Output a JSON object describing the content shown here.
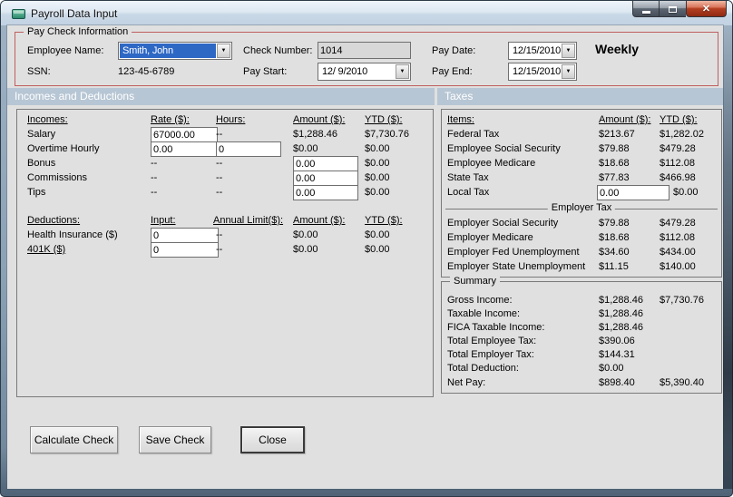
{
  "window": {
    "title": "Payroll Data Input",
    "close_glyph": "✕",
    "icons": [
      "form-icon",
      "minimize-icon",
      "maximize-icon",
      "close-icon",
      "chevron-down-icon"
    ]
  },
  "colors": {
    "selection_blue": "#2e68c5",
    "group_border_red": "#c05f5f",
    "panel_header_bg": "#b7c6d4",
    "client_bg": "#e0e0e0"
  },
  "paycheck": {
    "legend": "Pay Check Information",
    "employee_name_label": "Employee Name:",
    "employee_name_value": "Smith, John",
    "ssn_label": "SSN:",
    "ssn_value": "123-45-6789",
    "check_number_label": "Check Number:",
    "check_number_value": "1014",
    "pay_start_label": "Pay Start:",
    "pay_start_value": "12/ 9/2010",
    "pay_date_label": "Pay Date:",
    "pay_date_value": "12/15/2010",
    "pay_end_label": "Pay End:",
    "pay_end_value": "12/15/2010",
    "frequency": "Weekly",
    "dropdown_glyph": "▼"
  },
  "incomes_panel": {
    "header": "Incomes and Deductions",
    "income_headers": {
      "item": "Incomes:",
      "rate": "Rate ($):",
      "hours": "Hours:",
      "amount": "Amount ($):",
      "ytd": "YTD ($):"
    },
    "income_rows": [
      {
        "label": "Salary",
        "rate": "67000.00",
        "hours": "--",
        "amount": "$1,288.46",
        "ytd": "$7,730.76"
      },
      {
        "label": "Overtime Hourly",
        "rate": "0.00",
        "hours": "0",
        "amount": "$0.00",
        "ytd": "$0.00"
      },
      {
        "label": "Bonus",
        "rate": "--",
        "hours": "--",
        "amount": "0.00",
        "ytd": "$0.00"
      },
      {
        "label": "Commissions",
        "rate": "--",
        "hours": "--",
        "amount": "0.00",
        "ytd": "$0.00"
      },
      {
        "label": "Tips",
        "rate": "--",
        "hours": "--",
        "amount": "0.00",
        "ytd": "$0.00"
      }
    ],
    "deduction_headers": {
      "item": "Deductions:",
      "input": "Input:",
      "annual_limit": "Annual Limit($):",
      "amount": "Amount ($):",
      "ytd": "YTD ($):"
    },
    "deduction_rows": [
      {
        "label": "Health Insurance ($)",
        "input": "0",
        "annual_limit": "--",
        "amount": "$0.00",
        "ytd": "$0.00"
      },
      {
        "label": "401K ($)",
        "input": "0",
        "annual_limit": "--",
        "amount": "$0.00",
        "ytd": "$0.00"
      }
    ]
  },
  "taxes_panel": {
    "header": "Taxes",
    "headers": {
      "item": "Items:",
      "amount": "Amount ($):",
      "ytd": "YTD ($):"
    },
    "employee_rows": [
      {
        "label": "Federal Tax",
        "amount": "$213.67",
        "ytd": "$1,282.02"
      },
      {
        "label": "Employee Social Security",
        "amount": "$79.88",
        "ytd": "$479.28"
      },
      {
        "label": "Employee Medicare",
        "amount": "$18.68",
        "ytd": "$112.08"
      },
      {
        "label": "State Tax",
        "amount": "$77.83",
        "ytd": "$466.98"
      },
      {
        "label": "Local Tax",
        "amount": "0.00",
        "ytd": "$0.00"
      }
    ],
    "employer_group_label": "Employer Tax",
    "employer_rows": [
      {
        "label": "Employer Social Security",
        "amount": "$79.88",
        "ytd": "$479.28"
      },
      {
        "label": "Employer Medicare",
        "amount": "$18.68",
        "ytd": "$112.08"
      },
      {
        "label": "Employer Fed Unemployment",
        "amount": "$34.60",
        "ytd": "$434.00"
      },
      {
        "label": "Employer State Unemployment",
        "amount": "$11.15",
        "ytd": "$140.00"
      }
    ]
  },
  "summary": {
    "legend": "Summary",
    "rows": [
      {
        "label": "Gross Income:",
        "amount": "$1,288.46",
        "ytd": "$7,730.76"
      },
      {
        "label": "Taxable Income:",
        "amount": "$1,288.46",
        "ytd": ""
      },
      {
        "label": "FICA Taxable Income:",
        "amount": "$1,288.46",
        "ytd": ""
      },
      {
        "label": "Total Employee Tax:",
        "amount": "$390.06",
        "ytd": ""
      },
      {
        "label": "Total Employer Tax:",
        "amount": "$144.31",
        "ytd": ""
      },
      {
        "label": "Total Deduction:",
        "amount": "$0.00",
        "ytd": ""
      },
      {
        "label": "Net Pay:",
        "amount": "$898.40",
        "ytd": "$5,390.40"
      }
    ]
  },
  "buttons": {
    "calculate": "Calculate Check",
    "save": "Save Check",
    "close": "Close"
  }
}
